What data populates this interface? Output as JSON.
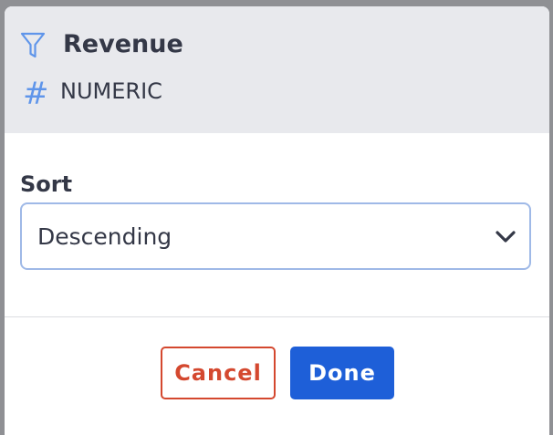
{
  "header": {
    "title": "Revenue",
    "type_label": "NUMERIC",
    "filter_icon": "filter-icon",
    "type_icon": "hash-icon",
    "type_glyph": "#"
  },
  "sort": {
    "label": "Sort",
    "selected": "Descending",
    "dropdown_icon": "chevron-down-icon"
  },
  "footer": {
    "cancel_label": "Cancel",
    "done_label": "Done"
  },
  "colors": {
    "accent": "#1e5fd8",
    "danger": "#d4482f",
    "icon_blue": "#5f95ea",
    "header_bg": "#e8e9ed",
    "select_border": "#9fb9e7",
    "text": "#343847"
  }
}
